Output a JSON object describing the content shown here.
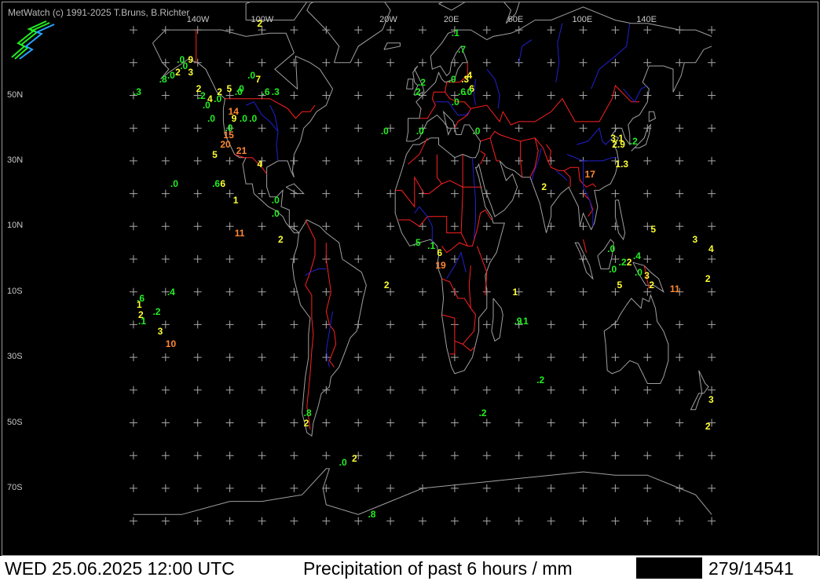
{
  "app": {
    "credit": "MetWatch  (c) 1991-2025 T.Bruns, B.Richter"
  },
  "map": {
    "lon_labels": [
      {
        "label": "140W",
        "lon": -140
      },
      {
        "label": "100W",
        "lon": -100
      },
      {
        "label": "20W",
        "lon": -20
      },
      {
        "label": "20E",
        "lon": 20
      },
      {
        "label": "60E",
        "lon": 60
      },
      {
        "label": "100E",
        "lon": 100
      },
      {
        "label": "140E",
        "lon": 140
      }
    ],
    "lat_labels": [
      {
        "label": "50N",
        "lat": 50
      },
      {
        "label": "30N",
        "lat": 30
      },
      {
        "label": "10N",
        "lat": 10
      },
      {
        "label": "10S",
        "lat": -10
      },
      {
        "label": "30S",
        "lat": -30
      },
      {
        "label": "50S",
        "lat": -50
      },
      {
        "label": "70S",
        "lat": -70
      }
    ],
    "colors": {
      "coast": "#a0a0a0",
      "borders": "#ff2020",
      "rivers": "#2020d0",
      "grid": "#a8a8a8",
      "low": "#22ee22",
      "mid": "#ffff33",
      "high": "#ff8833"
    },
    "observations": [
      {
        "v": "2",
        "lon": -103,
        "lat": 72,
        "c": "mid"
      },
      {
        "v": ".1",
        "lon": 18,
        "lat": 69,
        "c": "low"
      },
      {
        "v": ".7",
        "lon": 22,
        "lat": 64,
        "c": "low"
      },
      {
        "v": ".0",
        "lon": -153,
        "lat": 61,
        "c": "low"
      },
      {
        "v": "9",
        "lon": -146,
        "lat": 61,
        "c": "mid"
      },
      {
        "v": ".0",
        "lon": -151,
        "lat": 59,
        "c": "low"
      },
      {
        "v": "2",
        "lon": -154,
        "lat": 57,
        "c": "mid"
      },
      {
        "v": "3",
        "lon": -146,
        "lat": 57,
        "c": "mid"
      },
      {
        "v": ".8",
        "lon": -164,
        "lat": 55,
        "c": "low"
      },
      {
        "v": ".0",
        "lon": -159,
        "lat": 56,
        "c": "low"
      },
      {
        "v": ".0",
        "lon": -109,
        "lat": 56,
        "c": "low"
      },
      {
        "v": "7",
        "lon": -104,
        "lat": 55,
        "c": "mid"
      },
      {
        "v": ".4",
        "lon": 26,
        "lat": 56,
        "c": "mid"
      },
      {
        "v": ".3",
        "lon": 24,
        "lat": 55,
        "c": "mid"
      },
      {
        "v": ".2",
        "lon": -3,
        "lat": 54,
        "c": "low"
      },
      {
        "v": ".0",
        "lon": 16,
        "lat": 55,
        "c": "low"
      },
      {
        "v": "2",
        "lon": -141,
        "lat": 52,
        "c": "mid"
      },
      {
        "v": "5",
        "lon": -122,
        "lat": 52,
        "c": "mid"
      },
      {
        "v": ".0",
        "lon": -116,
        "lat": 52,
        "c": "low"
      },
      {
        "v": "6",
        "lon": 29,
        "lat": 52,
        "c": "mid"
      },
      {
        "v": ".3",
        "lon": -180,
        "lat": 51,
        "c": "low"
      },
      {
        "v": ".2",
        "lon": -140,
        "lat": 50,
        "c": "low"
      },
      {
        "v": "2",
        "lon": -128,
        "lat": 51,
        "c": "mid"
      },
      {
        "v": ".0",
        "lon": -117,
        "lat": 51,
        "c": "low"
      },
      {
        "v": ".6",
        "lon": -100,
        "lat": 51,
        "c": "low"
      },
      {
        "v": ".3",
        "lon": -94,
        "lat": 51,
        "c": "low"
      },
      {
        "v": ".2",
        "lon": -6,
        "lat": 51,
        "c": "low"
      },
      {
        "v": ".6",
        "lon": 22,
        "lat": 51,
        "c": "low"
      },
      {
        "v": ".0",
        "lon": 26,
        "lat": 51,
        "c": "low"
      },
      {
        "v": "4",
        "lon": -134,
        "lat": 49,
        "c": "mid"
      },
      {
        "v": ".0",
        "lon": -130,
        "lat": 49,
        "c": "low"
      },
      {
        "v": ".0",
        "lon": 18,
        "lat": 48,
        "c": "low"
      },
      {
        "v": ".0",
        "lon": -137,
        "lat": 47,
        "c": "low"
      },
      {
        "v": "14",
        "lon": -121,
        "lat": 45,
        "c": "high"
      },
      {
        "v": ".0",
        "lon": -134,
        "lat": 43,
        "c": "low"
      },
      {
        "v": "9",
        "lon": -119,
        "lat": 43,
        "c": "mid"
      },
      {
        "v": ".0",
        "lon": -114,
        "lat": 43,
        "c": "low"
      },
      {
        "v": ".0",
        "lon": -108,
        "lat": 43,
        "c": "low"
      },
      {
        "v": ".0",
        "lon": -26,
        "lat": 39,
        "c": "low"
      },
      {
        "v": ".0",
        "lon": -123,
        "lat": 40,
        "c": "low"
      },
      {
        "v": ".0",
        "lon": -4,
        "lat": 39,
        "c": "low"
      },
      {
        "v": ".0",
        "lon": 31,
        "lat": 39,
        "c": "low"
      },
      {
        "v": "15",
        "lon": -124,
        "lat": 38,
        "c": "high"
      },
      {
        "v": "3.1",
        "lon": 117,
        "lat": 37,
        "c": "mid"
      },
      {
        "v": "20",
        "lon": -126,
        "lat": 35,
        "c": "high"
      },
      {
        "v": "2.9",
        "lon": 118,
        "lat": 35,
        "c": "mid"
      },
      {
        "v": ".2",
        "lon": 129,
        "lat": 36,
        "c": "low"
      },
      {
        "v": "21",
        "lon": -116,
        "lat": 33,
        "c": "high"
      },
      {
        "v": "5",
        "lon": -131,
        "lat": 32,
        "c": "mid"
      },
      {
        "v": "1.3",
        "lon": 120,
        "lat": 29,
        "c": "mid"
      },
      {
        "v": "4",
        "lon": -103,
        "lat": 29,
        "c": "mid"
      },
      {
        "v": "17",
        "lon": 101,
        "lat": 26,
        "c": "high"
      },
      {
        "v": ".0",
        "lon": -157,
        "lat": 23,
        "c": "low"
      },
      {
        "v": ".6",
        "lon": -131,
        "lat": 23,
        "c": "low"
      },
      {
        "v": "6",
        "lon": -126,
        "lat": 23,
        "c": "mid"
      },
      {
        "v": "2",
        "lon": 74,
        "lat": 22,
        "c": "mid"
      },
      {
        "v": "1",
        "lon": -118,
        "lat": 18,
        "c": "mid"
      },
      {
        "v": ".0",
        "lon": -94,
        "lat": 18,
        "c": "low"
      },
      {
        "v": ".0",
        "lon": -94,
        "lat": 14,
        "c": "low"
      },
      {
        "v": "5",
        "lon": 142,
        "lat": 9,
        "c": "mid"
      },
      {
        "v": "11",
        "lon": -117,
        "lat": 8,
        "c": "high"
      },
      {
        "v": "3",
        "lon": 168,
        "lat": 6,
        "c": "mid"
      },
      {
        "v": "2",
        "lon": -90,
        "lat": 6,
        "c": "mid"
      },
      {
        "v": "4",
        "lon": 178,
        "lat": 3,
        "c": "mid"
      },
      {
        "v": ".5",
        "lon": -6,
        "lat": 5,
        "c": "low"
      },
      {
        "v": ".1",
        "lon": 3,
        "lat": 4,
        "c": "low"
      },
      {
        "v": ".0",
        "lon": 115,
        "lat": 3,
        "c": "low"
      },
      {
        "v": "6",
        "lon": 9,
        "lat": 2,
        "c": "mid"
      },
      {
        "v": ".4",
        "lon": 131,
        "lat": 1,
        "c": "low"
      },
      {
        "v": ".2",
        "lon": 122,
        "lat": -1,
        "c": "low"
      },
      {
        "v": "2",
        "lon": 127,
        "lat": -1,
        "c": "mid"
      },
      {
        "v": "19",
        "lon": 8,
        "lat": -2,
        "c": "high"
      },
      {
        "v": ".0",
        "lon": 116,
        "lat": -3,
        "c": "low"
      },
      {
        "v": ".0",
        "lon": 132,
        "lat": -4,
        "c": "low"
      },
      {
        "v": "3",
        "lon": 138,
        "lat": -5,
        "c": "mid"
      },
      {
        "v": "2",
        "lon": 176,
        "lat": -6,
        "c": "mid"
      },
      {
        "v": "2",
        "lon": -24,
        "lat": -8,
        "c": "mid"
      },
      {
        "v": "5",
        "lon": 121,
        "lat": -8,
        "c": "mid"
      },
      {
        "v": "2",
        "lon": 141,
        "lat": -8,
        "c": "mid"
      },
      {
        "v": "11",
        "lon": 154,
        "lat": -9,
        "c": "high"
      },
      {
        "v": ".4",
        "lon": -159,
        "lat": -10,
        "c": "low"
      },
      {
        "v": "1",
        "lon": 56,
        "lat": -10,
        "c": "mid"
      },
      {
        "v": ".6",
        "lon": -178,
        "lat": -12,
        "c": "low"
      },
      {
        "v": "1",
        "lon": -178,
        "lat": -14,
        "c": "mid"
      },
      {
        "v": ".2",
        "lon": -168,
        "lat": -16,
        "c": "low"
      },
      {
        "v": "2",
        "lon": -177,
        "lat": -17,
        "c": "mid"
      },
      {
        "v": ".1",
        "lon": -177,
        "lat": -19,
        "c": "low"
      },
      {
        "v": ".9",
        "lon": 57,
        "lat": -19,
        "c": "low"
      },
      {
        "v": ".1",
        "lon": 61,
        "lat": -19,
        "c": "low"
      },
      {
        "v": "3",
        "lon": -165,
        "lat": -22,
        "c": "mid"
      },
      {
        "v": "10",
        "lon": -160,
        "lat": -26,
        "c": "high"
      },
      {
        "v": ".2",
        "lon": 71,
        "lat": -37,
        "c": "low"
      },
      {
        "v": "3",
        "lon": 178,
        "lat": -43,
        "c": "mid"
      },
      {
        "v": ".8",
        "lon": -74,
        "lat": -47,
        "c": "low"
      },
      {
        "v": ".2",
        "lon": 35,
        "lat": -47,
        "c": "low"
      },
      {
        "v": "2",
        "lon": -74,
        "lat": -50,
        "c": "mid"
      },
      {
        "v": "2",
        "lon": 176,
        "lat": -51,
        "c": "mid"
      },
      {
        "v": "2",
        "lon": -44,
        "lat": -61,
        "c": "mid"
      },
      {
        "v": ".0",
        "lon": -52,
        "lat": -62,
        "c": "low"
      },
      {
        "v": ".8",
        "lon": -34,
        "lat": -78,
        "c": "low"
      }
    ]
  },
  "status": {
    "datetime": "WED 25.06.2025 12:00 UTC",
    "title": "Precipitation of past  6 hours  / mm",
    "count": "279/14541"
  }
}
